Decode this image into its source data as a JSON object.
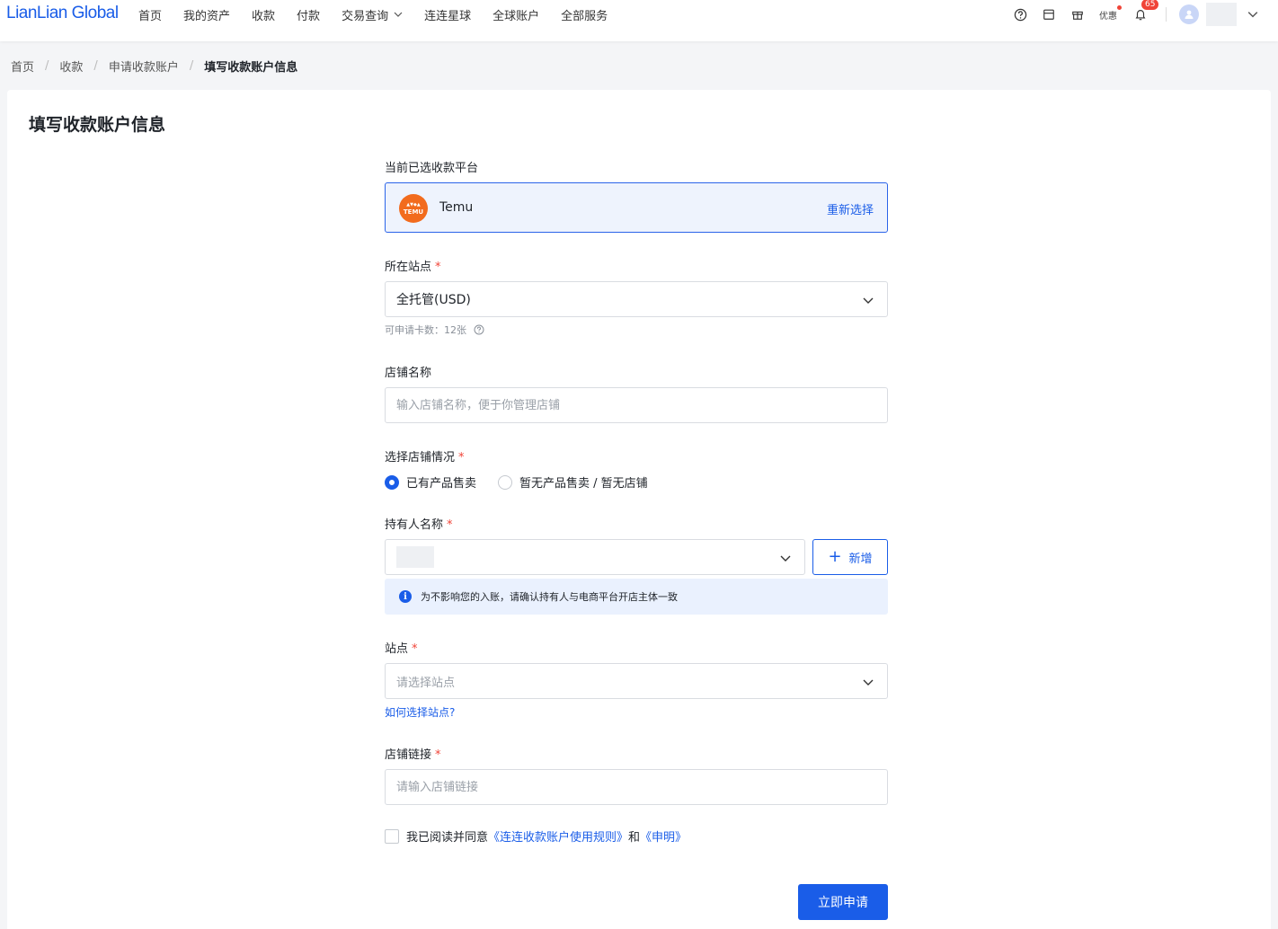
{
  "brand": {
    "logo_text": "LianLian Global"
  },
  "nav": {
    "items": [
      "首页",
      "我的资产",
      "收款",
      "付款",
      "交易查询",
      "连连星球",
      "全球账户",
      "全部服务"
    ]
  },
  "top_right": {
    "coupon_label": "优惠",
    "notification_count": "65"
  },
  "breadcrumb": {
    "items": [
      "首页",
      "收款",
      "申请收款账户"
    ],
    "current": "填写收款账户信息"
  },
  "page": {
    "title": "填写收款账户信息"
  },
  "form": {
    "platform": {
      "label": "当前已选收款平台",
      "name": "Temu",
      "logo_text": "TEMU",
      "reselect_label": "重新选择"
    },
    "site": {
      "label": "所在站点",
      "value": "全托管(USD)",
      "hint": "可申请卡数：12张"
    },
    "shop_name": {
      "label": "店铺名称",
      "placeholder": "输入店铺名称，便于你管理店铺"
    },
    "shop_status": {
      "label": "选择店铺情况",
      "options": [
        "已有产品售卖",
        "暂无产品售卖 / 暂无店铺"
      ],
      "selected": "已有产品售卖"
    },
    "holder": {
      "label": "持有人名称",
      "add_label": "新增",
      "info": "为不影响您的入账，请确认持有人与电商平台开店主体一致"
    },
    "station": {
      "label": "站点",
      "placeholder": "请选择站点",
      "help_link": "如何选择站点?"
    },
    "shop_link": {
      "label": "店铺链接",
      "placeholder": "请输入店铺链接"
    },
    "agreement": {
      "prefix": "我已阅读并同意",
      "rules_link": "《连连收款账户使用规则》",
      "and": "和",
      "statement_link": "《申明》"
    },
    "submit_label": "立即申请"
  },
  "colors": {
    "primary": "#1a5de8",
    "required": "#f04438",
    "temu_orange": "#f26b1d"
  }
}
